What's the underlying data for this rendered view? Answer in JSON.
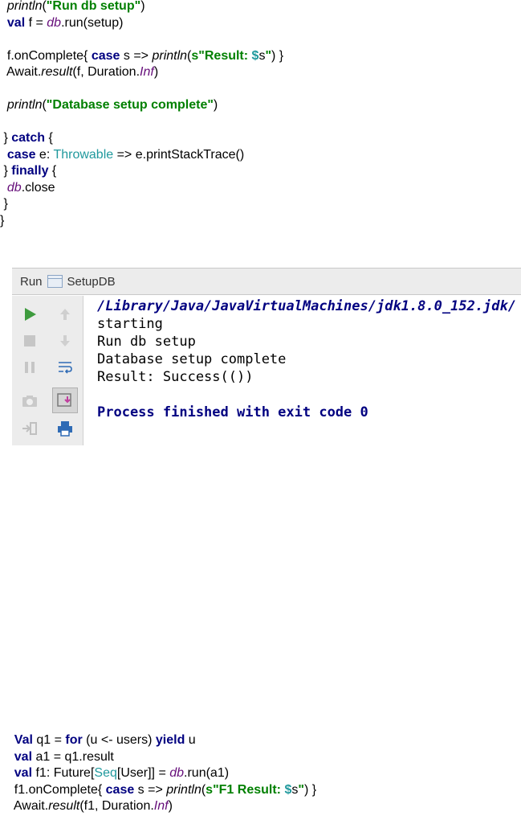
{
  "code_top": [
    [
      {
        "t": "  "
      },
      {
        "t": "println",
        "c": "fn"
      },
      {
        "t": "("
      },
      {
        "t": "\"Run db setup\"",
        "c": "str"
      },
      {
        "t": ")"
      }
    ],
    [
      {
        "t": "  "
      },
      {
        "t": "val",
        "c": "kw"
      },
      {
        "t": " f = "
      },
      {
        "t": "db",
        "c": "db"
      },
      {
        "t": ".run(setup)"
      }
    ],
    [
      {
        "t": ""
      }
    ],
    [
      {
        "t": "  f.onComplete{ "
      },
      {
        "t": "case",
        "c": "kw"
      },
      {
        "t": " s => "
      },
      {
        "t": "println",
        "c": "fn"
      },
      {
        "t": "("
      },
      {
        "t": "s\"Result: ",
        "c": "str"
      },
      {
        "t": "$",
        "c": "interp"
      },
      {
        "t": "s",
        "c": ""
      },
      {
        "t": "\"",
        "c": "str"
      },
      {
        "t": ") }"
      }
    ],
    [
      {
        "t": "  Await."
      },
      {
        "t": "result",
        "c": "fn"
      },
      {
        "t": "(f, Duration."
      },
      {
        "t": "Inf",
        "c": "inf"
      },
      {
        "t": ")"
      }
    ],
    [
      {
        "t": ""
      }
    ],
    [
      {
        "t": "  "
      },
      {
        "t": "println",
        "c": "fn"
      },
      {
        "t": "("
      },
      {
        "t": "\"Database setup complete\"",
        "c": "str"
      },
      {
        "t": ")"
      }
    ],
    [
      {
        "t": ""
      }
    ],
    [
      {
        "t": " } "
      },
      {
        "t": "catch",
        "c": "kw"
      },
      {
        "t": " {"
      }
    ],
    [
      {
        "t": "  "
      },
      {
        "t": "case",
        "c": "kw"
      },
      {
        "t": " e: "
      },
      {
        "t": "Throwable",
        "c": "type"
      },
      {
        "t": " => e.printStackTrace()"
      }
    ],
    [
      {
        "t": " } "
      },
      {
        "t": "finally",
        "c": "kw"
      },
      {
        "t": " {"
      }
    ],
    [
      {
        "t": "  "
      },
      {
        "t": "db",
        "c": "db"
      },
      {
        "t": ".close"
      }
    ],
    [
      {
        "t": " }"
      }
    ],
    [
      {
        "t": "}"
      }
    ]
  ],
  "run_panel": {
    "tab_label": "Run",
    "config_name": "SetupDB",
    "console_lines": [
      {
        "text": "/Library/Java/JavaVirtualMachines/jdk1.8.0_152.jdk/",
        "c": "path"
      },
      {
        "text": "starting",
        "c": ""
      },
      {
        "text": "Run db setup",
        "c": ""
      },
      {
        "text": "Database setup complete",
        "c": ""
      },
      {
        "text": "Result: Success(())",
        "c": ""
      },
      {
        "text": "",
        "c": ""
      },
      {
        "text": "Process finished with exit code 0",
        "c": "exit"
      }
    ],
    "icons_left": [
      "run-icon",
      "stop-icon",
      "pause-icon",
      "camera-icon",
      "exit-icon"
    ],
    "icons_right": [
      "up-arrow-icon",
      "down-arrow-icon",
      "soft-wrap-icon",
      "scroll-to-end-icon",
      "print-icon"
    ]
  },
  "code_bottom": [
    [
      {
        "t": "    "
      },
      {
        "t": "Val",
        "c": "kw"
      },
      {
        "t": " q1 = "
      },
      {
        "t": "for",
        "c": "kw"
      },
      {
        "t": " (u <- users) "
      },
      {
        "t": "yield",
        "c": "kw"
      },
      {
        "t": " u"
      }
    ],
    [
      {
        "t": "    "
      },
      {
        "t": "val",
        "c": "kw"
      },
      {
        "t": " a1 = q1.result"
      }
    ],
    [
      {
        "t": "    "
      },
      {
        "t": "val",
        "c": "kw"
      },
      {
        "t": " f1: Future["
      },
      {
        "t": "Seq",
        "c": "type"
      },
      {
        "t": "[User]] = "
      },
      {
        "t": "db",
        "c": "db"
      },
      {
        "t": ".run(a1)"
      }
    ],
    [
      {
        "t": "    f1.onComplete{ "
      },
      {
        "t": "case",
        "c": "kw"
      },
      {
        "t": " s => "
      },
      {
        "t": "println",
        "c": "fn"
      },
      {
        "t": "("
      },
      {
        "t": "s\"F1 Result: ",
        "c": "str"
      },
      {
        "t": "$",
        "c": "interp"
      },
      {
        "t": "s",
        "c": ""
      },
      {
        "t": "\"",
        "c": "str"
      },
      {
        "t": ") }"
      }
    ],
    [
      {
        "t": "    Await."
      },
      {
        "t": "result",
        "c": "fn"
      },
      {
        "t": "(f1, Duration."
      },
      {
        "t": "Inf",
        "c": "inf"
      },
      {
        "t": ")"
      }
    ]
  ]
}
